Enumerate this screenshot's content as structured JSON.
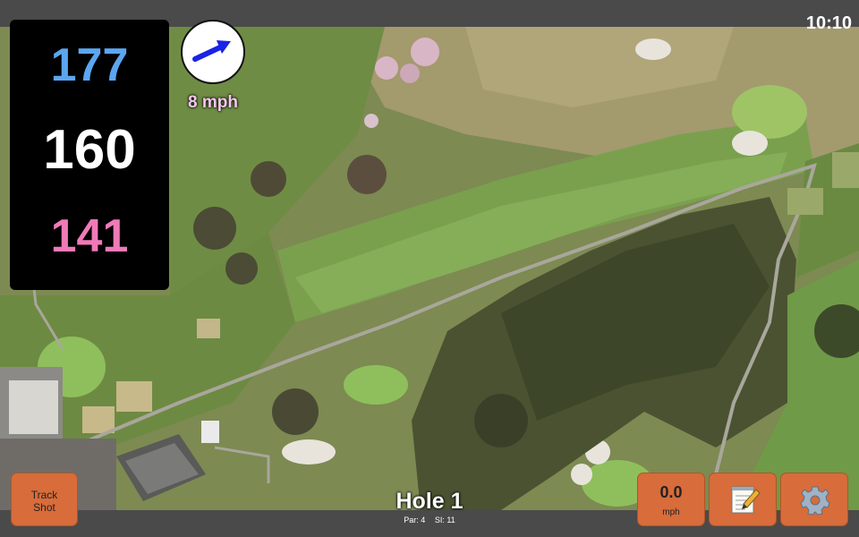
{
  "status": {
    "time": "10:10"
  },
  "yardage": {
    "back": "177",
    "middle": "160",
    "front": "141",
    "back_color": "#5ba6f0",
    "middle_color": "#ffffff",
    "front_color": "#f07ab8"
  },
  "wind": {
    "speed": "8 mph",
    "direction_icon": "wind-arrow-icon",
    "speed_color": "#f6c8ee",
    "arrow_color": "#1a22e6"
  },
  "hole": {
    "title": "Hole 1",
    "par": "Par: 4",
    "si": "SI: 11"
  },
  "buttons": {
    "track_shot_line1": "Track",
    "track_shot_line2": "Shot",
    "speed_value": "0.0",
    "speed_unit": "mph",
    "notes_icon": "notepad-icon",
    "settings_icon": "gear-icon",
    "accent": "#d86c3a"
  },
  "map": {
    "type": "satellite-course-view"
  }
}
